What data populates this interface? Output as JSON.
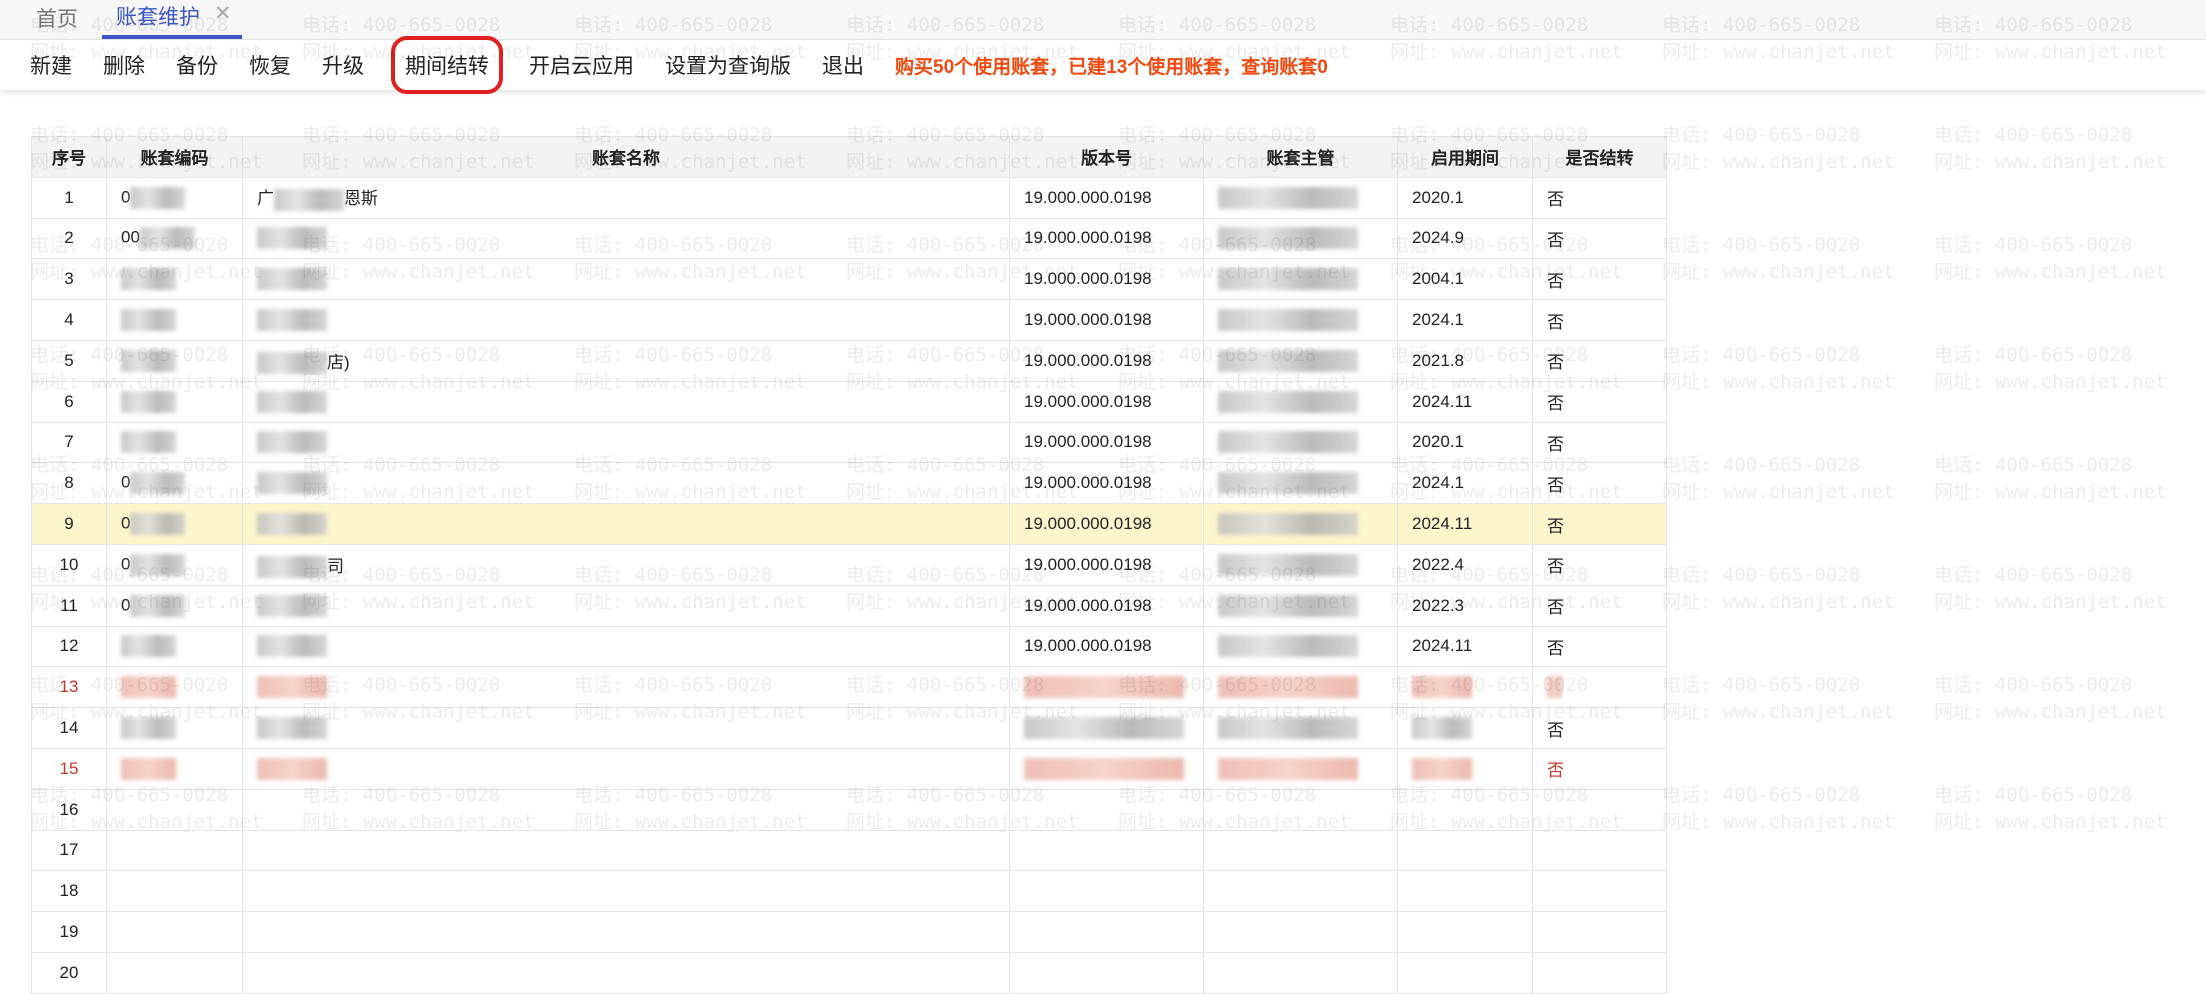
{
  "tabs": [
    {
      "label": "首页",
      "active": false
    },
    {
      "label": "账套维护",
      "active": true,
      "close": "✕"
    }
  ],
  "toolbar": {
    "buttons": [
      "新建",
      "删除",
      "备份",
      "恢复",
      "升级",
      "期间结转",
      "开启云应用",
      "设置为查询版",
      "退出"
    ],
    "highlighted": "期间结转",
    "notice": "购买50个使用账套，已建13个使用账套，查询账套0"
  },
  "table": {
    "headers": [
      "序号",
      "账套编码",
      "账套名称",
      "版本号",
      "账套主管",
      "启用期间",
      "是否结转"
    ],
    "rows": [
      {
        "no": "1",
        "code": "0",
        "name": "广",
        "name_tail": "恩斯",
        "ver": "19.000.000.0198",
        "period": "2020.1",
        "carry": "否"
      },
      {
        "no": "2",
        "code": "00",
        "name": "",
        "ver": "19.000.000.0198",
        "period": "2024.9",
        "carry": "否"
      },
      {
        "no": "3",
        "code": "",
        "name": "",
        "ver": "19.000.000.0198",
        "period": "2004.1",
        "carry": "否"
      },
      {
        "no": "4",
        "code": "",
        "name": "",
        "ver": "19.000.000.0198",
        "period": "2024.1",
        "carry": "否"
      },
      {
        "no": "5",
        "code": "",
        "name": "",
        "name_tail": "店)",
        "ver": "19.000.000.0198",
        "period": "2021.8",
        "carry": "否"
      },
      {
        "no": "6",
        "code": "",
        "name": "",
        "ver": "19.000.000.0198",
        "period": "2024.11",
        "carry": "否"
      },
      {
        "no": "7",
        "code": "",
        "name": "",
        "ver": "19.000.000.0198",
        "period": "2020.1",
        "carry": "否"
      },
      {
        "no": "8",
        "code": "0",
        "name": "",
        "ver": "19.000.000.0198",
        "period": "2024.1",
        "carry": "否"
      },
      {
        "no": "9",
        "code": "0",
        "name": "",
        "ver": "19.000.000.0198",
        "period": "2024.11",
        "carry": "否",
        "selected": true
      },
      {
        "no": "10",
        "code": "0",
        "name": "",
        "name_tail": "司",
        "ver": "19.000.000.0198",
        "period": "2022.4",
        "carry": "否"
      },
      {
        "no": "11",
        "code": "0",
        "name": "",
        "ver": "19.000.000.0198",
        "period": "2022.3",
        "carry": "否"
      },
      {
        "no": "12",
        "code": "",
        "name": "",
        "ver": "19.000.000.0198",
        "period": "2024.11",
        "carry": "否"
      },
      {
        "no": "13",
        "code": "",
        "name": "",
        "ver": "",
        "period": "",
        "carry": "",
        "red": true
      },
      {
        "no": "14",
        "code": "",
        "name": "",
        "ver": "",
        "period": "",
        "carry": "否"
      },
      {
        "no": "15",
        "code": "",
        "name": "",
        "ver": "",
        "period": "",
        "carry": "否",
        "red": true
      },
      {
        "no": "16"
      },
      {
        "no": "17"
      },
      {
        "no": "18"
      },
      {
        "no": "19"
      },
      {
        "no": "20"
      }
    ]
  },
  "watermark": {
    "phone": "电话: 400-665-0028",
    "site": "网址: www.chanjet.net"
  }
}
